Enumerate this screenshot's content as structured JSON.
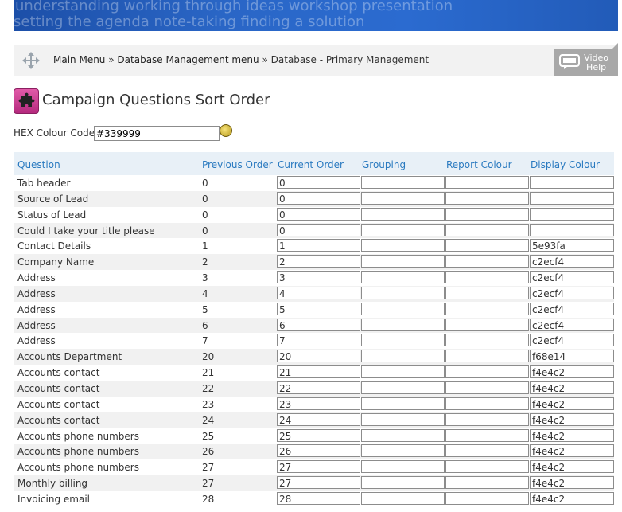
{
  "banner": {
    "line1": "understanding  working through  ideas workshop  presentation",
    "line2": "setting the agenda   note-taking   finding a solution"
  },
  "breadcrumb": {
    "main_menu": "Main Menu",
    "sep1": "»",
    "db_menu": "Database Management menu",
    "sep2": "»",
    "current": "Database - Primary Management"
  },
  "video_help": {
    "line1": "Video",
    "line2": "Help"
  },
  "page": {
    "title": "Campaign Questions Sort Order"
  },
  "hex": {
    "label": "HEX Colour Code :",
    "value": "#339999"
  },
  "table": {
    "headers": {
      "question": "Question",
      "previous": "Previous Order",
      "current": "Current Order",
      "grouping": "Grouping",
      "report": "Report Colour",
      "display": "Display Colour"
    },
    "rows": [
      {
        "q": "Tab header",
        "p": "0",
        "c": "0",
        "g": "",
        "r": "",
        "d": ""
      },
      {
        "q": "Source of Lead",
        "p": "0",
        "c": "0",
        "g": "",
        "r": "",
        "d": ""
      },
      {
        "q": "Status of Lead",
        "p": "0",
        "c": "0",
        "g": "",
        "r": "",
        "d": ""
      },
      {
        "q": "Could I take your title please",
        "p": "0",
        "c": "0",
        "g": "",
        "r": "",
        "d": ""
      },
      {
        "q": "Contact Details",
        "p": "1",
        "c": "1",
        "g": "",
        "r": "",
        "d": "5e93fa"
      },
      {
        "q": "Company Name",
        "p": "2",
        "c": "2",
        "g": "",
        "r": "",
        "d": "c2ecf4"
      },
      {
        "q": "Address",
        "p": "3",
        "c": "3",
        "g": "",
        "r": "",
        "d": "c2ecf4"
      },
      {
        "q": "Address",
        "p": "4",
        "c": "4",
        "g": "",
        "r": "",
        "d": "c2ecf4"
      },
      {
        "q": "Address",
        "p": "5",
        "c": "5",
        "g": "",
        "r": "",
        "d": "c2ecf4"
      },
      {
        "q": "Address",
        "p": "6",
        "c": "6",
        "g": "",
        "r": "",
        "d": "c2ecf4"
      },
      {
        "q": "Address",
        "p": "7",
        "c": "7",
        "g": "",
        "r": "",
        "d": "c2ecf4"
      },
      {
        "q": "Accounts Department",
        "p": "20",
        "c": "20",
        "g": "",
        "r": "",
        "d": "f68e14"
      },
      {
        "q": "Accounts contact",
        "p": "21",
        "c": "21",
        "g": "",
        "r": "",
        "d": "f4e4c2"
      },
      {
        "q": "Accounts contact",
        "p": "22",
        "c": "22",
        "g": "",
        "r": "",
        "d": "f4e4c2"
      },
      {
        "q": "Accounts contact",
        "p": "23",
        "c": "23",
        "g": "",
        "r": "",
        "d": "f4e4c2"
      },
      {
        "q": "Accounts contact",
        "p": "24",
        "c": "24",
        "g": "",
        "r": "",
        "d": "f4e4c2"
      },
      {
        "q": "Accounts phone numbers",
        "p": "25",
        "c": "25",
        "g": "",
        "r": "",
        "d": "f4e4c2"
      },
      {
        "q": "Accounts phone numbers",
        "p": "26",
        "c": "26",
        "g": "",
        "r": "",
        "d": "f4e4c2"
      },
      {
        "q": "Accounts phone numbers",
        "p": "27",
        "c": "27",
        "g": "",
        "r": "",
        "d": "f4e4c2"
      },
      {
        "q": "Monthly billing",
        "p": "27",
        "c": "27",
        "g": "",
        "r": "",
        "d": "f4e4c2"
      },
      {
        "q": "Invoicing email",
        "p": "28",
        "c": "28",
        "g": "",
        "r": "",
        "d": "f4e4c2"
      }
    ]
  }
}
